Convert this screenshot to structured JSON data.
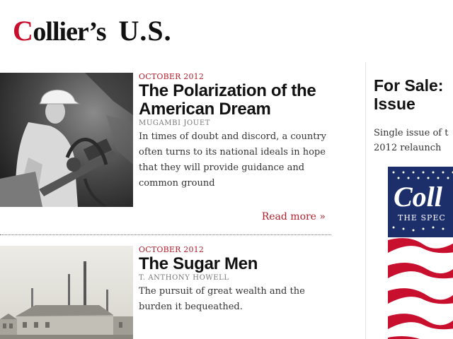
{
  "site": {
    "logo_first": "C",
    "logo_rest": "ollier’s",
    "edition": "U.S."
  },
  "articles": [
    {
      "date": "OCTOBER 2012",
      "title": "The Polarization of the American Dream",
      "author": "MUGAMBI JOUET",
      "summary": "In times of doubt and discord, a country often turns to its national ideals in hope that they will provide guidance and common ground",
      "read_more": "Read more »"
    },
    {
      "date": "OCTOBER 2012",
      "title": "The Sugar Men",
      "author": "T. ANTHONY HOWELL",
      "summary": "The pursuit of great wealth and the burden it bequeathed."
    }
  ],
  "sidebar": {
    "title": "For Sale:\nIssue",
    "description": "Single issue of t\n2012 relaunch",
    "cover_masthead": "Coll",
    "cover_tagline": "THE SPEC"
  }
}
